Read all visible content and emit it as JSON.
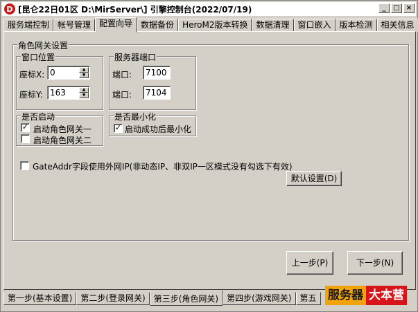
{
  "window": {
    "title": "[昆仑22日01区 D:\\MirServer\\] 引擎控制台(2022/07/19)",
    "icon_letter": "D",
    "controls": {
      "minimize": "_",
      "maximize": "□",
      "close": "×"
    }
  },
  "top_tabs": [
    "服务端控制",
    "帐号管理",
    "配置向导",
    "数据备份",
    "HeroM2版本转换",
    "数据清理",
    "窗口嵌入",
    "版本检测",
    "相关信息"
  ],
  "active_top_tab": "配置向导",
  "gateway_settings": {
    "title": "角色网关设置",
    "window_position": {
      "title": "窗口位置",
      "x_label": "座标X:",
      "x_value": "0",
      "y_label": "座标Y:",
      "y_value": "163"
    },
    "server_port": {
      "title": "服务器端口",
      "port1_label": "端口:",
      "port1_value": "7100",
      "port2_label": "端口:",
      "port2_value": "7104"
    },
    "enable_group": {
      "title": "是否启动",
      "gate1_label": "启动角色网关一",
      "gate1_checked": "✓",
      "gate2_label": "启动角色网关二",
      "gate2_checked": ""
    },
    "minimize_group": {
      "title": "是否最小化",
      "minimize_label": "启动成功后最小化",
      "minimize_checked": "✓"
    },
    "gateaddr_label": "GateAddr字段使用外网IP(非动态IP、非双IP一区模式没有勾选下有效)",
    "gateaddr_checked": "",
    "default_button": "默认设置(D)"
  },
  "nav": {
    "prev_button": "上一步(P)",
    "next_button": "下一步(N)"
  },
  "bottom_tabs": [
    "第一步(基本设置)",
    "第二步(登录网关)",
    "第三步(角色网关)",
    "第四步(游戏网关)",
    "第五"
  ],
  "active_bottom_tab": "第三步(角色网关)",
  "watermark": {
    "part1": "服务器",
    "part2": "大本营"
  }
}
